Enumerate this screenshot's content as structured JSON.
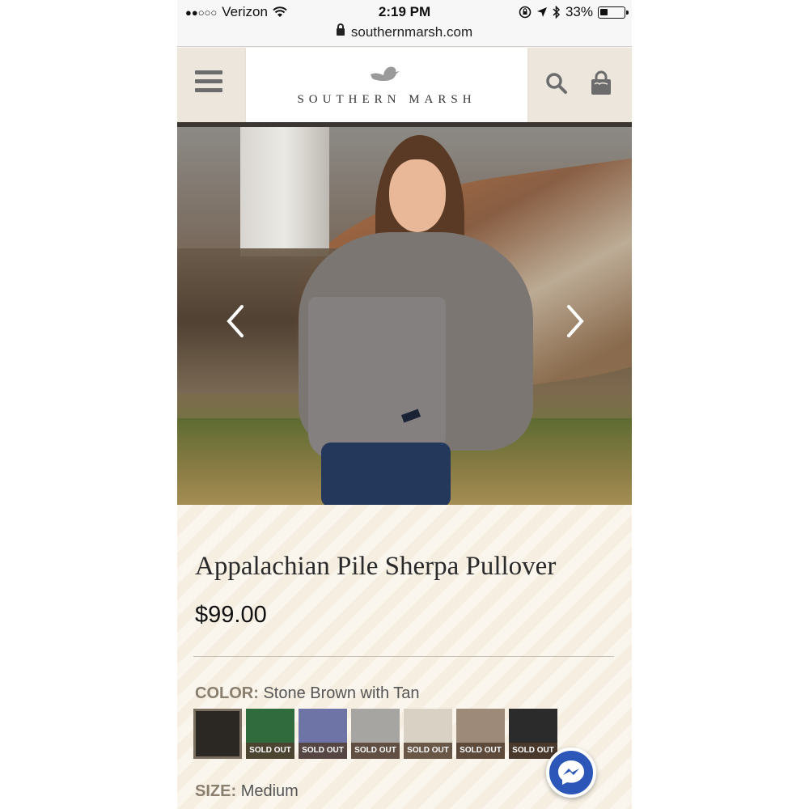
{
  "status_bar": {
    "signal": "●●○○○",
    "carrier": "Verizon",
    "time": "2:19 PM",
    "battery_text": "33%",
    "battery_level": 0.33
  },
  "url_bar": {
    "url": "southernmarsh.com"
  },
  "header": {
    "brand": "SOUTHERN MARSH"
  },
  "product": {
    "title": "Appalachian Pile Sherpa Pullover",
    "price": "$99.00",
    "color_label": "COLOR:",
    "color_value": "Stone Brown with Tan",
    "swatches": [
      {
        "color": "#2b2824",
        "status": "",
        "selected": true
      },
      {
        "color": "#2f6b3d",
        "status": "SOLD OUT"
      },
      {
        "color": "#6f74a6",
        "status": "SOLD OUT"
      },
      {
        "color": "#a7a5a2",
        "status": "SOLD OUT"
      },
      {
        "color": "#d9d1c4",
        "status": "SOLD OUT"
      },
      {
        "color": "#9d8a78",
        "status": "SOLD OUT"
      },
      {
        "color": "#2a2b2a",
        "status": "SOLD OUT"
      }
    ],
    "size_label": "SIZE:",
    "size_value": "Medium"
  },
  "colors": {
    "header_bg": "#ece6dc",
    "messenger": "#2c57b8"
  }
}
